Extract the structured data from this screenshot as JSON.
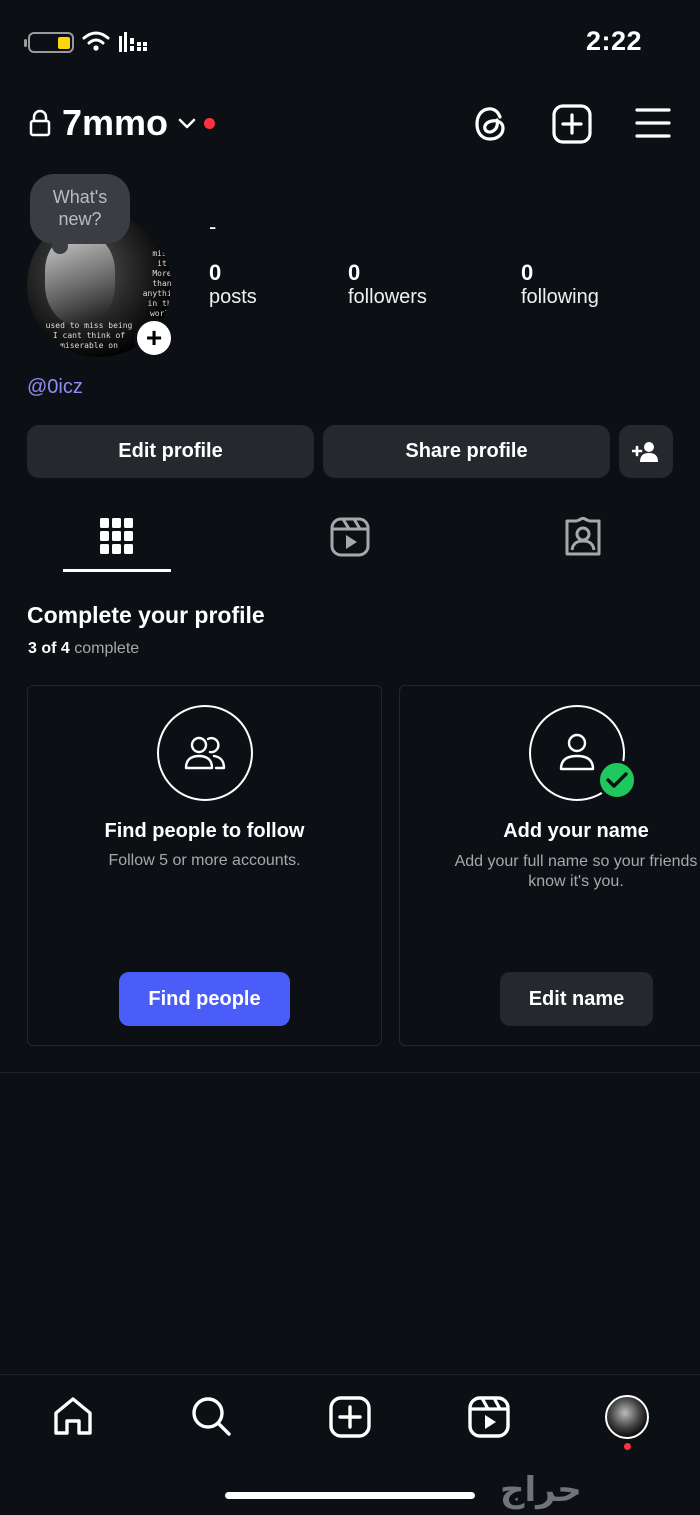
{
  "status_bar": {
    "time": "2:22"
  },
  "header": {
    "username": "7mmo"
  },
  "note": {
    "text_line1": "What's",
    "text_line2": "new?"
  },
  "avatar_text": {
    "right_lines": [
      "miss",
      "it",
      "More",
      "than",
      "anything",
      "in the",
      "world"
    ],
    "bottom_lines": [
      "used to miss being",
      "I cant think of",
      "miserable on"
    ]
  },
  "profile": {
    "bio_name": "-",
    "stats": [
      {
        "value": "0",
        "label": "posts"
      },
      {
        "value": "0",
        "label": "followers"
      },
      {
        "value": "0",
        "label": "following"
      }
    ],
    "handle": "@0icz"
  },
  "buttons": {
    "edit_profile": "Edit profile",
    "share_profile": "Share profile"
  },
  "complete_profile": {
    "title": "Complete your profile",
    "progress_done": "3 of 4",
    "progress_word": "complete",
    "cards": [
      {
        "title": "Find people to follow",
        "description": "Follow 5 or more accounts.",
        "button": "Find people",
        "completed": false
      },
      {
        "title": "Add your name",
        "description_line1": "Add your full name so your friends",
        "description_line2": "know it's you.",
        "button": "Edit name",
        "completed": true
      }
    ]
  },
  "watermark": "حراج",
  "colors": {
    "background": "#0c1014",
    "accent": "#4a5df9",
    "link": "#8e8cf5",
    "notification": "#ff3040",
    "success": "#1ec85c",
    "battery": "#ffd60a"
  }
}
